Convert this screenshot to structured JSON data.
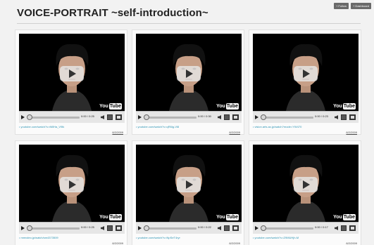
{
  "top_buttons": [
    {
      "label": "+ Follow"
    },
    {
      "label": "+ Dashboard"
    }
  ],
  "page_title": "VOICE-PORTRAIT ~self-introduction~",
  "videos": [
    {
      "time": "0:00 / 0:25",
      "link": "• youtube.com/watch?v=tMIHa_V9lk",
      "date": "8/2/2009"
    },
    {
      "time": "0:00 / 0:30",
      "link": "• youtube.com/watch?v=qR6lg-Vl8",
      "date": "8/2/2009"
    },
    {
      "time": "0:00 / 0:23",
      "link": "• vision.arts.ac.jp/watch?mode=YW470",
      "date": "8/2/2009"
    },
    {
      "time": "0:00 / 0:25",
      "link": "• mmvdeo.jp/watch/sm4373509",
      "date": "8/2/2009"
    },
    {
      "time": "0:00 / 0:22",
      "link": "• youtube.com/watch?v=NpSeT4ryr",
      "date": "8/2/2009"
    },
    {
      "time": "0:00 / 0:17",
      "link": "• youtube.com/watch?v=Z9MUHjh-M",
      "date": "8/2/2009"
    }
  ],
  "player": {
    "logo_you": "You",
    "logo_tube": "Tube",
    "play_icon": "play-icon",
    "volume_icon": "volume-icon",
    "embed_icon": "embed-icon",
    "fullscreen_icon": "fullscreen-icon"
  },
  "colors": {
    "link": "#2a93b3",
    "background": "#f2f2f2",
    "player_bg": "#000000"
  }
}
